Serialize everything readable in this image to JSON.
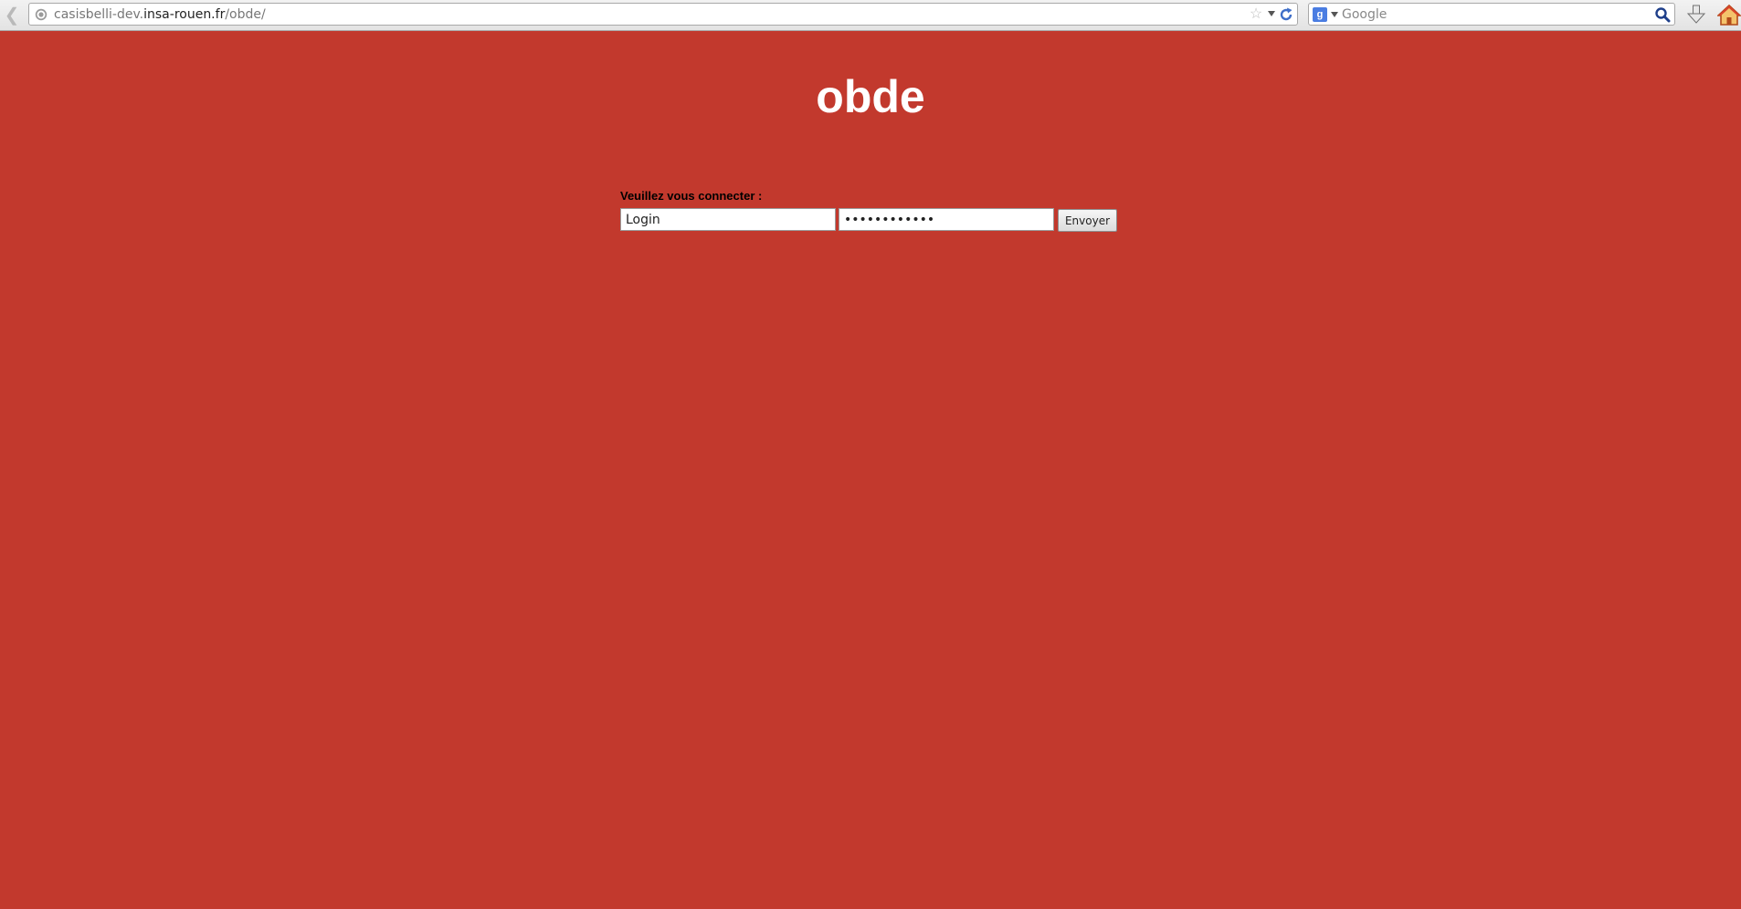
{
  "browser": {
    "url_prefix": "casisbelli-dev.",
    "url_domain": "insa-rouen.fr",
    "url_path": "/obde/",
    "search_placeholder": "Google",
    "search_engine_glyph": "g"
  },
  "page": {
    "title": "obde",
    "background_color": "#c2392d"
  },
  "login": {
    "prompt": "Veuillez vous connecter :",
    "login_value": "Login",
    "password_value": "motdepassexx",
    "submit_label": "Envoyer"
  },
  "icons": {
    "back": "back-arrow-icon",
    "site": "globe-icon",
    "bookmark": "star-icon",
    "reload": "reload-icon",
    "search_engine": "google-icon",
    "search_go": "magnifier-icon",
    "download": "download-arrow-icon",
    "home": "home-icon"
  }
}
